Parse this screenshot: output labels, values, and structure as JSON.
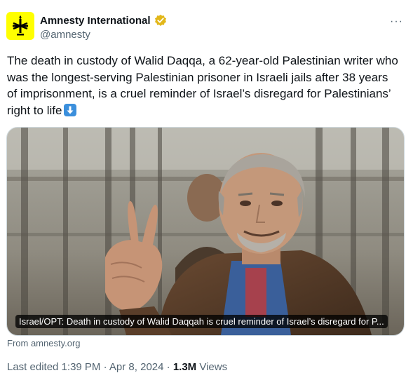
{
  "author": {
    "display_name": "Amnesty International",
    "handle": "@amnesty"
  },
  "more_glyph": "···",
  "tweet": {
    "text": "The death in custody of Walid Daqqa, a 62-year-old Palestinian writer who was the longest-serving Palestinian prisoner in Israeli jails after 38 years of imprisonment, is a cruel reminder of Israel’s disregard for Palestinians’ right to life"
  },
  "link_card": {
    "caption": "Israel/OPT: Death in custody of Walid Daqqah is cruel reminder of Israel’s disregard for P...",
    "source": "From amnesty.org"
  },
  "meta": {
    "edited": "Last edited 1:39 PM · Apr 8, 2024 · ",
    "views_count": "1.3M",
    "views_label": " Views"
  },
  "colors": {
    "accent_yellow": "#ffff00",
    "secondary_text": "#536471",
    "verified_gold": "#e2b719"
  }
}
